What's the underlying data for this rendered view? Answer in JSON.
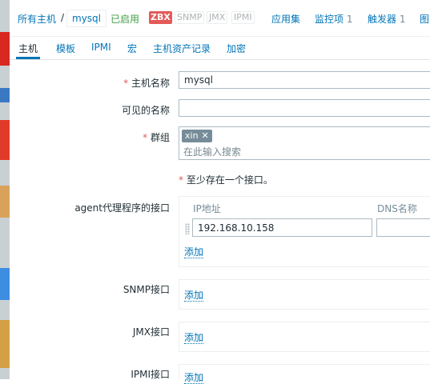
{
  "breadcrumb": {
    "all_hosts": "所有主机",
    "separator": "/",
    "current_host": "mysql",
    "status": "已启用",
    "availability": [
      "ZBX",
      "SNMP",
      "JMX",
      "IPMI"
    ],
    "links": [
      {
        "label": "应用集"
      },
      {
        "label": "监控项",
        "count": "1"
      },
      {
        "label": "触发器",
        "count": "1"
      },
      {
        "label": "图"
      }
    ]
  },
  "tabs": [
    "主机",
    "模板",
    "IPMI",
    "宏",
    "主机资产记录",
    "加密"
  ],
  "form": {
    "host_name": {
      "label": "主机名称",
      "value": "mysql",
      "required": "*"
    },
    "visible_name": {
      "label": "可见的名称",
      "value": ""
    },
    "groups": {
      "label": "群组",
      "required": "*",
      "chips": [
        "xin"
      ],
      "placeholder": "在此输入搜索"
    },
    "interface_note": "至少存在一个接口。",
    "agent": {
      "label": "agent代理程序的接口",
      "col_ip": "IP地址",
      "col_dns": "DNS名称",
      "ip_value": "192.168.10.158",
      "add": "添加"
    },
    "snmp": {
      "label": "SNMP接口",
      "add": "添加"
    },
    "jmx": {
      "label": "JMX接口",
      "add": "添加"
    },
    "ipmi": {
      "label": "IPMI接口",
      "add": "添加"
    }
  },
  "colors": {
    "accent": "#0275b8",
    "enabled": "#429e47",
    "zbx": "#e45959",
    "required": "#e45959"
  }
}
